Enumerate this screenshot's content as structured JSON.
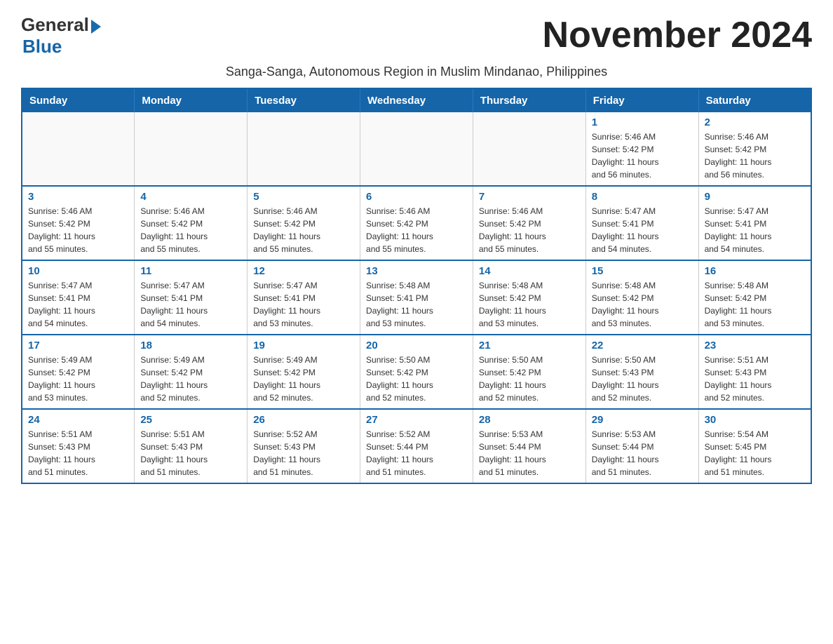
{
  "header": {
    "logo_general": "General",
    "logo_blue": "Blue",
    "month_title": "November 2024",
    "subtitle": "Sanga-Sanga, Autonomous Region in Muslim Mindanao, Philippines"
  },
  "calendar": {
    "days_of_week": [
      "Sunday",
      "Monday",
      "Tuesday",
      "Wednesday",
      "Thursday",
      "Friday",
      "Saturday"
    ],
    "weeks": [
      [
        {
          "day": "",
          "info": ""
        },
        {
          "day": "",
          "info": ""
        },
        {
          "day": "",
          "info": ""
        },
        {
          "day": "",
          "info": ""
        },
        {
          "day": "",
          "info": ""
        },
        {
          "day": "1",
          "info": "Sunrise: 5:46 AM\nSunset: 5:42 PM\nDaylight: 11 hours\nand 56 minutes."
        },
        {
          "day": "2",
          "info": "Sunrise: 5:46 AM\nSunset: 5:42 PM\nDaylight: 11 hours\nand 56 minutes."
        }
      ],
      [
        {
          "day": "3",
          "info": "Sunrise: 5:46 AM\nSunset: 5:42 PM\nDaylight: 11 hours\nand 55 minutes."
        },
        {
          "day": "4",
          "info": "Sunrise: 5:46 AM\nSunset: 5:42 PM\nDaylight: 11 hours\nand 55 minutes."
        },
        {
          "day": "5",
          "info": "Sunrise: 5:46 AM\nSunset: 5:42 PM\nDaylight: 11 hours\nand 55 minutes."
        },
        {
          "day": "6",
          "info": "Sunrise: 5:46 AM\nSunset: 5:42 PM\nDaylight: 11 hours\nand 55 minutes."
        },
        {
          "day": "7",
          "info": "Sunrise: 5:46 AM\nSunset: 5:42 PM\nDaylight: 11 hours\nand 55 minutes."
        },
        {
          "day": "8",
          "info": "Sunrise: 5:47 AM\nSunset: 5:41 PM\nDaylight: 11 hours\nand 54 minutes."
        },
        {
          "day": "9",
          "info": "Sunrise: 5:47 AM\nSunset: 5:41 PM\nDaylight: 11 hours\nand 54 minutes."
        }
      ],
      [
        {
          "day": "10",
          "info": "Sunrise: 5:47 AM\nSunset: 5:41 PM\nDaylight: 11 hours\nand 54 minutes."
        },
        {
          "day": "11",
          "info": "Sunrise: 5:47 AM\nSunset: 5:41 PM\nDaylight: 11 hours\nand 54 minutes."
        },
        {
          "day": "12",
          "info": "Sunrise: 5:47 AM\nSunset: 5:41 PM\nDaylight: 11 hours\nand 53 minutes."
        },
        {
          "day": "13",
          "info": "Sunrise: 5:48 AM\nSunset: 5:41 PM\nDaylight: 11 hours\nand 53 minutes."
        },
        {
          "day": "14",
          "info": "Sunrise: 5:48 AM\nSunset: 5:42 PM\nDaylight: 11 hours\nand 53 minutes."
        },
        {
          "day": "15",
          "info": "Sunrise: 5:48 AM\nSunset: 5:42 PM\nDaylight: 11 hours\nand 53 minutes."
        },
        {
          "day": "16",
          "info": "Sunrise: 5:48 AM\nSunset: 5:42 PM\nDaylight: 11 hours\nand 53 minutes."
        }
      ],
      [
        {
          "day": "17",
          "info": "Sunrise: 5:49 AM\nSunset: 5:42 PM\nDaylight: 11 hours\nand 53 minutes."
        },
        {
          "day": "18",
          "info": "Sunrise: 5:49 AM\nSunset: 5:42 PM\nDaylight: 11 hours\nand 52 minutes."
        },
        {
          "day": "19",
          "info": "Sunrise: 5:49 AM\nSunset: 5:42 PM\nDaylight: 11 hours\nand 52 minutes."
        },
        {
          "day": "20",
          "info": "Sunrise: 5:50 AM\nSunset: 5:42 PM\nDaylight: 11 hours\nand 52 minutes."
        },
        {
          "day": "21",
          "info": "Sunrise: 5:50 AM\nSunset: 5:42 PM\nDaylight: 11 hours\nand 52 minutes."
        },
        {
          "day": "22",
          "info": "Sunrise: 5:50 AM\nSunset: 5:43 PM\nDaylight: 11 hours\nand 52 minutes."
        },
        {
          "day": "23",
          "info": "Sunrise: 5:51 AM\nSunset: 5:43 PM\nDaylight: 11 hours\nand 52 minutes."
        }
      ],
      [
        {
          "day": "24",
          "info": "Sunrise: 5:51 AM\nSunset: 5:43 PM\nDaylight: 11 hours\nand 51 minutes."
        },
        {
          "day": "25",
          "info": "Sunrise: 5:51 AM\nSunset: 5:43 PM\nDaylight: 11 hours\nand 51 minutes."
        },
        {
          "day": "26",
          "info": "Sunrise: 5:52 AM\nSunset: 5:43 PM\nDaylight: 11 hours\nand 51 minutes."
        },
        {
          "day": "27",
          "info": "Sunrise: 5:52 AM\nSunset: 5:44 PM\nDaylight: 11 hours\nand 51 minutes."
        },
        {
          "day": "28",
          "info": "Sunrise: 5:53 AM\nSunset: 5:44 PM\nDaylight: 11 hours\nand 51 minutes."
        },
        {
          "day": "29",
          "info": "Sunrise: 5:53 AM\nSunset: 5:44 PM\nDaylight: 11 hours\nand 51 minutes."
        },
        {
          "day": "30",
          "info": "Sunrise: 5:54 AM\nSunset: 5:45 PM\nDaylight: 11 hours\nand 51 minutes."
        }
      ]
    ]
  }
}
